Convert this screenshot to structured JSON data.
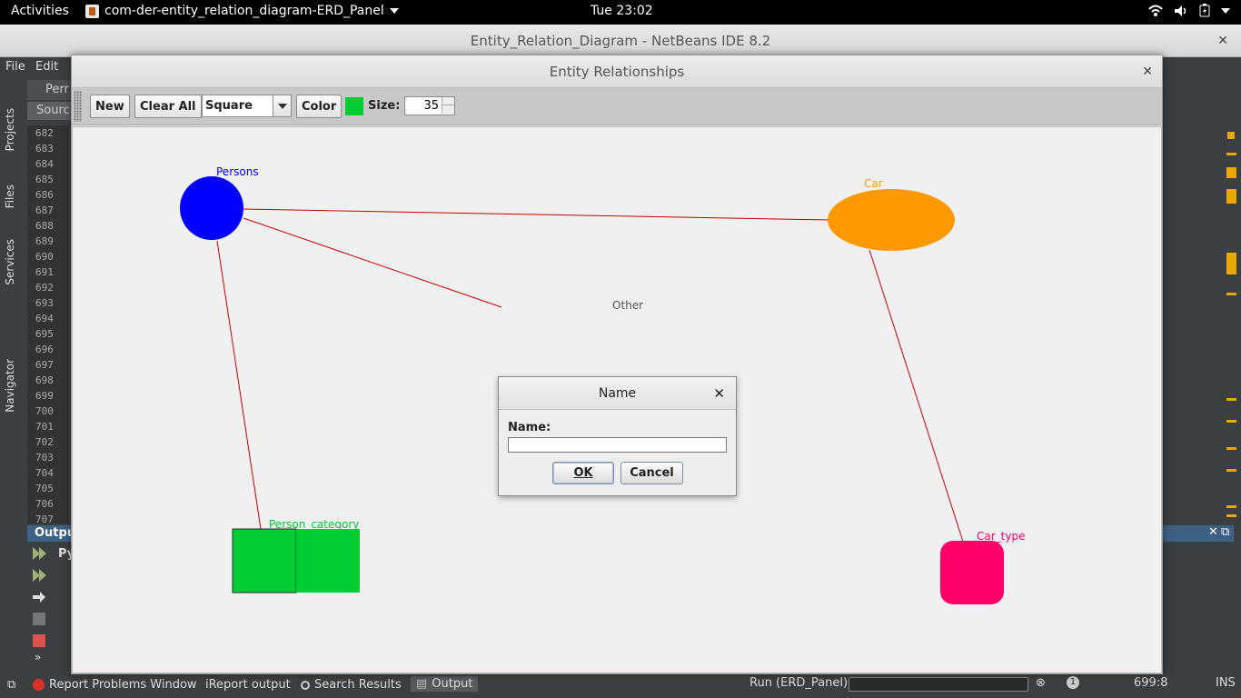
{
  "topbar": {
    "activities": "Activities",
    "app_name": "com-der-entity_relation_diagram-ERD_Panel",
    "clock": "Tue 23:02"
  },
  "ide": {
    "window_title": "Entity_Relation_Diagram - NetBeans IDE 8.2",
    "menu": [
      "File",
      "Edit"
    ],
    "editor_tab": "Perr",
    "source_tab": "Sourc",
    "side_tabs": [
      "Projects",
      "Files",
      "Services",
      "Navigator"
    ],
    "line_numbers": [
      "682",
      "683",
      "684",
      "685",
      "686",
      "687",
      "688",
      "689",
      "690",
      "691",
      "692",
      "693",
      "694",
      "695",
      "696",
      "697",
      "698",
      "699",
      "700",
      "701",
      "702",
      "703",
      "704",
      "705",
      "706",
      "707"
    ],
    "output_tab": "Outpu",
    "output_text": "Py"
  },
  "statusbar": {
    "report_problems": "Report Problems Window",
    "ireport": "iReport output",
    "search_results": "Search Results",
    "output": "Output",
    "run_label": "Run (ERD_Panel)",
    "position": "699:8",
    "mode": "INS",
    "notifications": "1"
  },
  "app": {
    "title": "Entity Relationships",
    "toolbar": {
      "new_label": "New",
      "clear_label": "Clear All",
      "shape_value": "Square",
      "color_label": "Color",
      "swatch_color": "#00cc33",
      "size_label": "Size:",
      "size_value": "35"
    },
    "entities": [
      {
        "name": "Persons",
        "shape": "circle",
        "color": "#0000ff"
      },
      {
        "name": "Car",
        "shape": "ellipse",
        "color": "#ff9900"
      },
      {
        "name": "Person_category",
        "shape": "square",
        "color": "#00cc33"
      },
      {
        "name": "Car_type",
        "shape": "rounded-square",
        "color": "#ff0066"
      },
      {
        "name": "Other",
        "shape": "hidden",
        "color": "#555555"
      }
    ],
    "relation_color": "#cc0000"
  },
  "dialog": {
    "title": "Name",
    "field_label": "Name:",
    "field_value": "",
    "ok_label": "OK",
    "cancel_label": "Cancel"
  }
}
